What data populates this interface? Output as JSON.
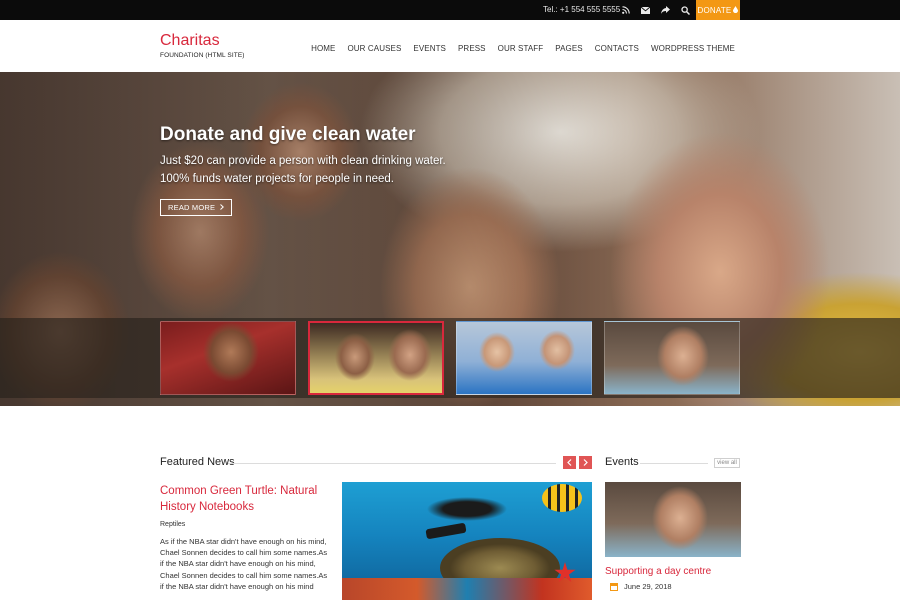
{
  "topbar": {
    "tel": "Tel.: +1 554 555 5555",
    "donate_label": "DONATE",
    "icons": [
      "rss-icon",
      "mail-icon",
      "share-icon",
      "search-icon"
    ],
    "donate_color": "#f39814"
  },
  "header": {
    "logo": "Charitas",
    "tagline": "FOUNDATION (HTML SITE)",
    "nav": [
      "HOME",
      "OUR CAUSES",
      "EVENTS",
      "PRESS",
      "OUR STAFF",
      "PAGES",
      "CONTACTS",
      "WORDPRESS THEME"
    ],
    "brand_color": "#d8283c"
  },
  "hero": {
    "title": "Donate and give clean water",
    "text": "Just $20 can provide a person with clean drinking water. 100% funds water projects for people in need.",
    "button": "READ MORE",
    "active_thumb": 1
  },
  "featured": {
    "title": "Featured News",
    "news_title": "Common Green Turtle: Natural History Notebooks",
    "category": "Reptiles",
    "text": "As if the NBA star didn't have enough on his mind, Chael Sonnen decides to call him some names.As if the NBA star didn't have enough on his mind, Chael Sonnen decides to call him some names.As if the NBA star didn't have enough on his mind"
  },
  "events": {
    "title": "Events",
    "view_all": "view all",
    "event_title": "Supporting a day centre",
    "event_date": "June 29, 2018"
  }
}
